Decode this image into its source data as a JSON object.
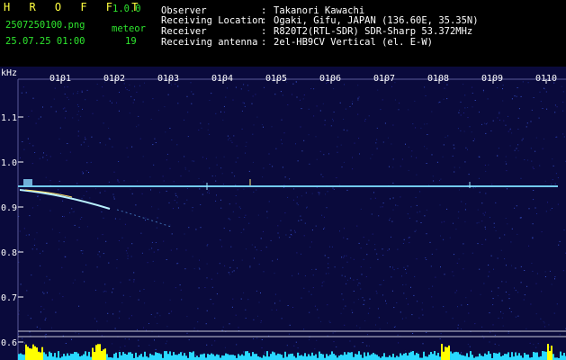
{
  "app": {
    "name": "H R O F F T",
    "version": "1.0.0"
  },
  "file": {
    "name": "2507250100.png",
    "datetime": "25.07.25 01:00"
  },
  "counter": {
    "label": "meteor",
    "value": "19"
  },
  "info": [
    {
      "label": "Observer",
      "sep": ":",
      "value": "Takanori Kawachi"
    },
    {
      "label": "Receiving Location",
      "sep": ":",
      "value": "Ogaki, Gifu, JAPAN (136.60E, 35.35N)"
    },
    {
      "label": "Receiver",
      "sep": ":",
      "value": "R820T2(RTL-SDR) SDR-Sharp 53.372MHz"
    },
    {
      "label": "Receiving antenna",
      "sep": ":",
      "value": "2el-HB9CV Vertical (el. E-W)"
    }
  ],
  "axis": {
    "unit": "kHz",
    "y_ticks": [
      "1.1",
      "1.0",
      "0.9",
      "0.8",
      "0.7",
      "0.6"
    ],
    "x_ticks": [
      "0101",
      "0102",
      "0103",
      "0104",
      "0105",
      "0106",
      "0107",
      "0108",
      "0109",
      "0110"
    ]
  },
  "colors": {
    "background": "#000000",
    "spectrogram_bg": "#0a0a3c",
    "header_text": "#2ee62e",
    "title_text": "#ffff40",
    "info_text": "#ffffff",
    "carrier": "#6ad7ff",
    "meteor_trail": "#b8f0ff",
    "bar_yellow": "#ffff00",
    "bar_cyan": "#29d8ff"
  }
}
